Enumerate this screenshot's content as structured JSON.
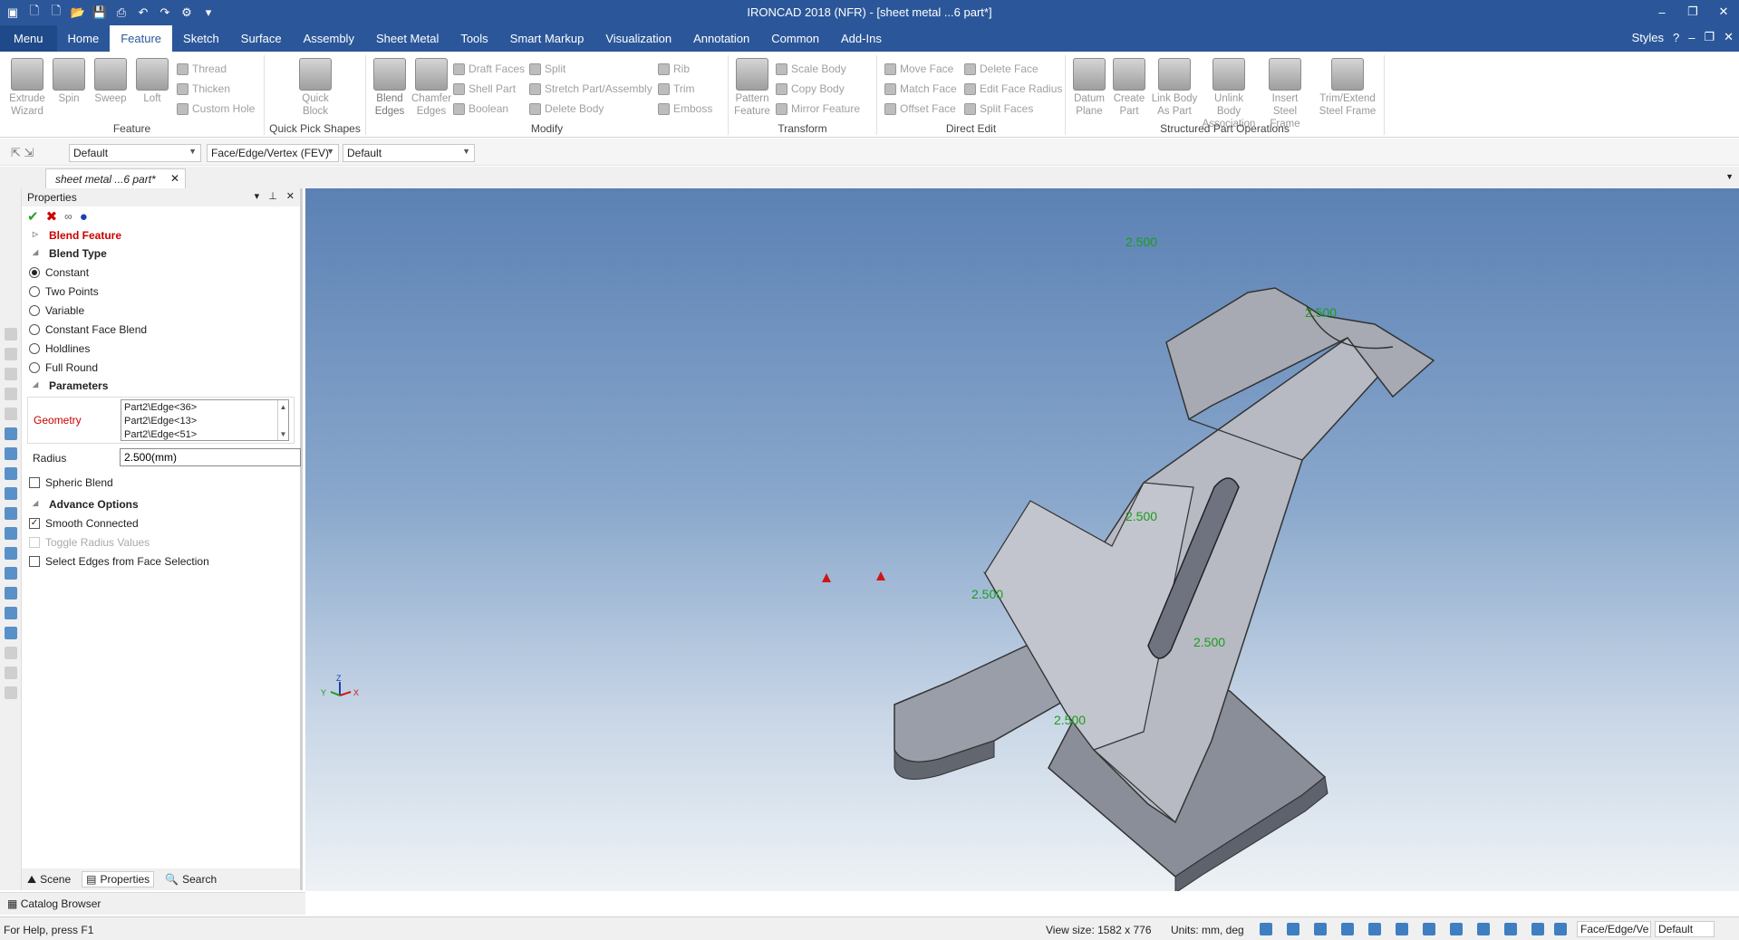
{
  "window": {
    "title": "IRONCAD 2018 (NFR) - [sheet metal ...6 part*]",
    "minimize": "‒",
    "restore": "❐",
    "close": "✕"
  },
  "menu": {
    "tabs": [
      "Menu",
      "Home",
      "Feature",
      "Sketch",
      "Surface",
      "Assembly",
      "Sheet Metal",
      "Tools",
      "Smart Markup",
      "Visualization",
      "Annotation",
      "Common",
      "Add-Ins"
    ],
    "active": "Feature",
    "styles": "Styles"
  },
  "ribbon": {
    "feature": {
      "label": "Feature",
      "extrude": "Extrude Wizard",
      "spin": "Spin",
      "sweep": "Sweep",
      "loft": "Loft",
      "thread": "Thread",
      "thicken": "Thicken",
      "custom_hole": "Custom Hole"
    },
    "quick": {
      "label": "Quick Pick Shapes",
      "quick_block": "Quick Block"
    },
    "modify": {
      "label": "Modify",
      "blend": "Blend Edges",
      "chamfer": "Chamfer Edges",
      "draft": "Draft Faces",
      "shell": "Shell Part",
      "boolean": "Boolean",
      "split": "Split",
      "stretch": "Stretch Part/Assembly",
      "delete_body": "Delete Body",
      "rib": "Rib",
      "trim": "Trim",
      "emboss": "Emboss"
    },
    "transform": {
      "label": "Transform",
      "pattern": "Pattern Feature",
      "scale": "Scale Body",
      "copy": "Copy Body",
      "mirror": "Mirror Feature"
    },
    "direct": {
      "label": "Direct Edit",
      "move_face": "Move Face",
      "match_face": "Match Face",
      "offset_face": "Offset Face",
      "delete_face": "Delete Face",
      "edit_radius": "Edit Face Radius",
      "split_faces": "Split Faces"
    },
    "structured": {
      "label": "Structured Part Operations",
      "datum": "Datum Plane",
      "create_part": "Create Part",
      "link_body": "Link Body As Part",
      "unlink": "Unlink Body Association",
      "insert_steel": "Insert Steel Frame",
      "trim_steel": "Trim/Extend Steel Frame"
    }
  },
  "toolbar": {
    "combo1": "Default",
    "combo2": "Face/Edge/Vertex (FEV)",
    "combo3": "Default"
  },
  "doc_tab": "sheet metal ...6 part*",
  "properties": {
    "title": "Properties",
    "blend_feature": "Blend Feature",
    "blend_type": "Blend Type",
    "options": [
      "Constant",
      "Two Points",
      "Variable",
      "Constant Face Blend",
      "Holdlines",
      "Full Round"
    ],
    "selected": "Constant",
    "parameters": "Parameters",
    "geometry_label": "Geometry",
    "geometry": [
      "Part2\\Edge<36>",
      "Part2\\Edge<13>",
      "Part2\\Edge<51>"
    ],
    "radius_label": "Radius",
    "radius_value": "2.500(mm)",
    "spheric": "Spheric Blend",
    "advance": "Advance Options",
    "smooth": "Smooth Connected",
    "toggle": "Toggle Radius Values",
    "select_edges": "Select Edges from Face Selection",
    "foot": [
      "Scene",
      "Properties",
      "Search"
    ]
  },
  "catalog": "Catalog Browser",
  "viewport": {
    "labels": [
      "2.500",
      "2.500",
      "2.500",
      "2.500",
      "2.500",
      "2.500"
    ],
    "axes": [
      "Z",
      "Y",
      "X"
    ]
  },
  "status": {
    "help": "For Help, press F1",
    "view_size": "View size: 1582 x  776",
    "units": "Units: mm, deg",
    "combo1": "Face/Edge/Ve",
    "combo2": "Default"
  }
}
